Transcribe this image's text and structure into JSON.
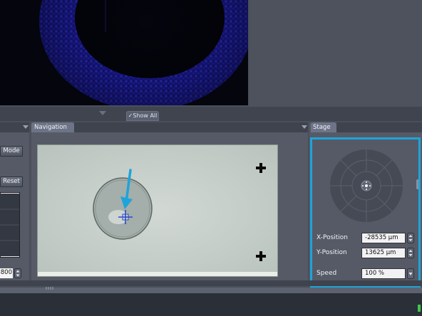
{
  "toolbar": {
    "show_all_label": "Show All"
  },
  "left_panel": {
    "mode_button": "Mode",
    "reset_button": "Reset",
    "value": "800"
  },
  "navigation": {
    "tab_label": "Navigation"
  },
  "stage": {
    "tab_label": "Stage",
    "x_label": "X-Position",
    "x_value": "-28535 µm",
    "y_label": "Y-Position",
    "y_value": "13625 µm",
    "speed_label": "Speed",
    "speed_value": "100 %"
  },
  "colors": {
    "highlight": "#1ea4d9",
    "fluorescence": "#2a2ad0",
    "panel": "#555a66"
  }
}
